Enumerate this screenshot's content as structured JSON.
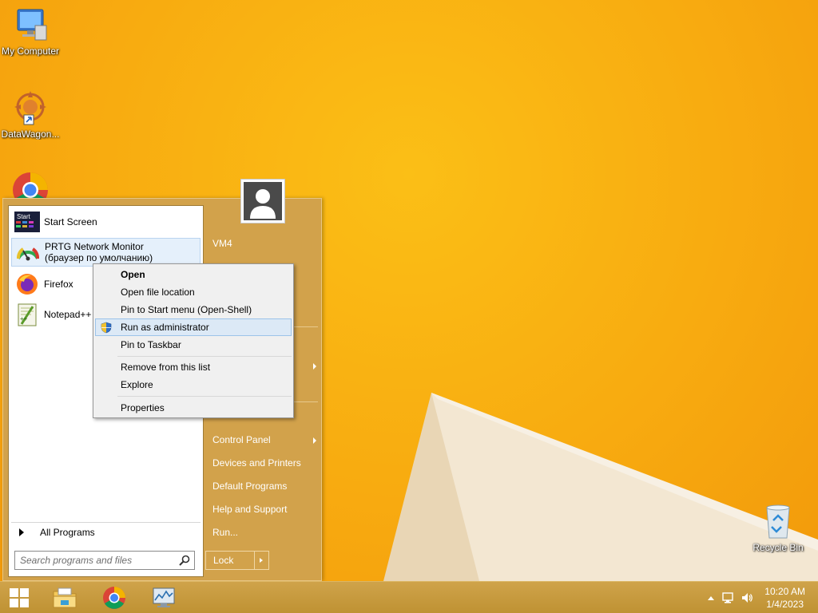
{
  "desktop": {
    "icons": [
      {
        "label": "My Computer",
        "icon": "computer-icon"
      },
      {
        "label": "DataWagon...",
        "icon": "datawagon-icon"
      },
      {
        "label": "Recycle Bin",
        "icon": "recycle-bin-icon"
      }
    ]
  },
  "start_menu": {
    "programs": [
      {
        "label": "Start Screen",
        "icon": "start-screen-icon"
      },
      {
        "label_line1": "PRTG Network Monitor",
        "label_line2": "(браузер по умолчанию)",
        "icon": "prtg-icon"
      },
      {
        "label": "Firefox",
        "icon": "firefox-icon"
      },
      {
        "label": "Notepad++",
        "icon": "notepadpp-icon"
      }
    ],
    "all_programs": "All Programs",
    "search_placeholder": "Search programs and files",
    "user_name": "VM4",
    "right_items": {
      "control_panel": "Control Panel",
      "devices_printers": "Devices and Printers",
      "default_programs": "Default Programs",
      "help_support": "Help and Support",
      "run": "Run..."
    },
    "lock_label": "Lock"
  },
  "context_menu": {
    "items": [
      "Open",
      "Open file location",
      "Pin to Start menu (Open-Shell)",
      "Run as administrator",
      "Pin to Taskbar",
      "Remove from this list",
      "Explore",
      "Properties"
    ],
    "highlighted_index": 3
  },
  "taskbar": {
    "time": "10:20 AM",
    "date": "1/4/2023"
  },
  "colors": {
    "wallpaper": "#f7a30f",
    "taskbar": "#c79a3a",
    "start_menu": "#d2a24b",
    "highlight": "#dce9f6"
  }
}
